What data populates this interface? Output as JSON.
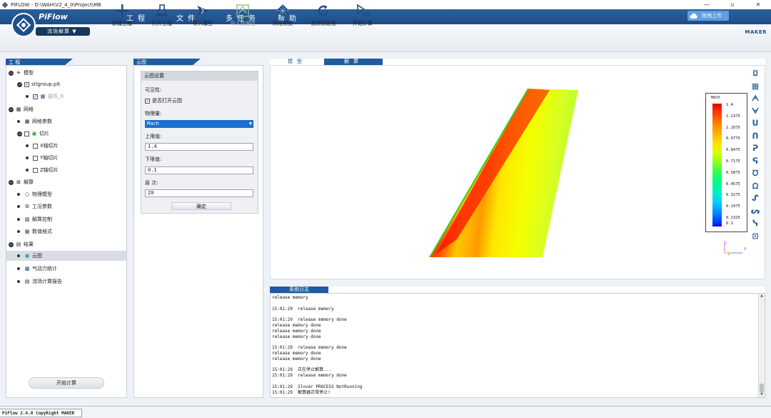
{
  "window": {
    "title": "PIFLOW - D:\\WAH\\V2_4_0\\Project\\M6",
    "minimize": "—",
    "restore": "▫",
    "close": "✕"
  },
  "logo": {
    "brand": "PiFlow",
    "module": "流场解算 ▼"
  },
  "menu": {
    "items": [
      "工程",
      "文件",
      "多任务",
      "帮助"
    ]
  },
  "upload": {
    "label": "拖拽上传"
  },
  "maker": "MAKER",
  "toolbar": {
    "new_project": "新建工程",
    "open_project": "打开工程",
    "import_model": "导入模型",
    "import_data": "导入数据组",
    "mesh_preview": "网格预览",
    "flow_init": "流场初始化",
    "start_calc": "开始计算"
  },
  "project_panel": {
    "title": "工 程",
    "tree": {
      "model": "模型",
      "stl_file": "stlgroup.plt",
      "part": "部件_0",
      "mesh": "网格",
      "mesh_params": "网格参数",
      "slice": "切片",
      "x_slice": "X轴切片",
      "y_slice": "Y轴切片",
      "z_slice": "Z轴切片",
      "solve": "解算",
      "physical_model": "物理模型",
      "conditions": "工况参数",
      "solve_control": "解算控制",
      "numeric_format": "数值格式",
      "results": "结果",
      "cloud": "云图",
      "aero_stats": "气动力统计",
      "flow_report": "流场计算报告"
    },
    "start_button": "开始计算"
  },
  "cloud_panel": {
    "title": "云图",
    "section": "云图设置",
    "visibility_label": "可见性:",
    "open_cloud_label": "是否打开云图",
    "quantity_label": "物理量:",
    "quantity_value": "Mach",
    "upper_label": "上限值:",
    "upper_value": "1.4",
    "lower_label": "下限值:",
    "lower_value": "0.1",
    "levels_label": "层  次:",
    "levels_value": "20",
    "confirm": "确定"
  },
  "viewport": {
    "tabs": [
      "模型",
      "解算"
    ],
    "active_tab": 1,
    "legend": {
      "title": "MACH",
      "labels": [
        "1.4",
        "1.2375",
        "1.1075",
        "0.9775",
        "0.8475",
        "0.7175",
        "0.5875",
        "0.4575",
        "0.3275",
        "0.1975",
        "0.1325",
        "0.1"
      ]
    },
    "view_icons": [
      "reset-view",
      "fit-view",
      "front-view",
      "back-view",
      "left-view",
      "right-view",
      "top-view",
      "bottom-view",
      "iso-view-1",
      "iso-view-2",
      "iso-view-3",
      "iso-view-4",
      "iso-view-5",
      "iso-view-6"
    ],
    "axes": {
      "y": "Y",
      "x": "X",
      "z": "Z"
    }
  },
  "log_panel": {
    "title": "系统日志",
    "lines": [
      "release memory",
      "",
      "15:01:29  release memory",
      "",
      "15:01:29  release memory done",
      "release memory done",
      "release memory done",
      "release memory done",
      "",
      "15:01:29  release memory done",
      "release memory done",
      "release memory done",
      "",
      "15:01:29  正在停止解算...",
      "15:01:29  release memory done",
      "",
      "15:01:29  Slover PROCESS NotRunning",
      "15:01:29  解算器正常停止!"
    ]
  },
  "status_bar": {
    "text": "PiFlow 2.4.0 CopyRight MAKER"
  },
  "colors": {
    "brand_blue": "#1f5b9e",
    "menu_blue": "#2b5f9c",
    "select_blue": "#1a6fd0"
  }
}
